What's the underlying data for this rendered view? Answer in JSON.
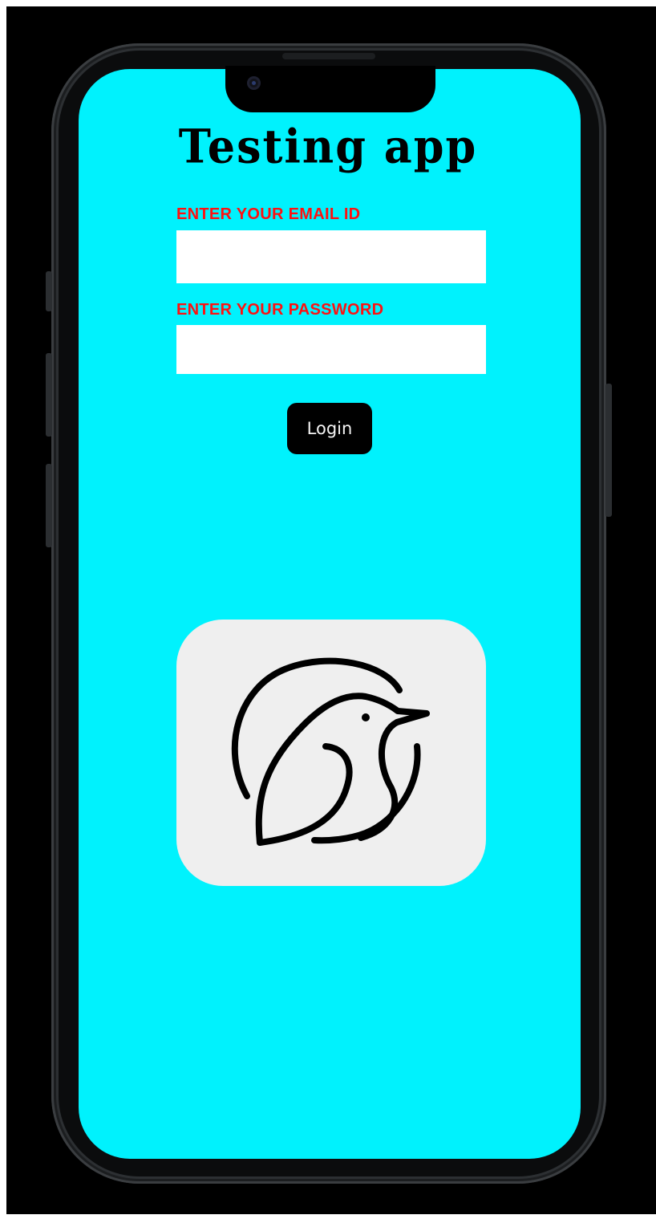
{
  "app": {
    "title": "Testing app"
  },
  "login_form": {
    "email_label": "ENTER YOUR EMAIL ID",
    "email_value": "",
    "password_label": "ENTER YOUR PASSWORD",
    "password_value": "",
    "login_button_label": "Login"
  },
  "logo": {
    "icon": "bird-logo-icon"
  },
  "colors": {
    "screen_background": "#00f2fd",
    "label_color": "#ff1010",
    "button_background": "#000000",
    "logo_card_background": "#efefef",
    "outer_background": "#000000"
  }
}
